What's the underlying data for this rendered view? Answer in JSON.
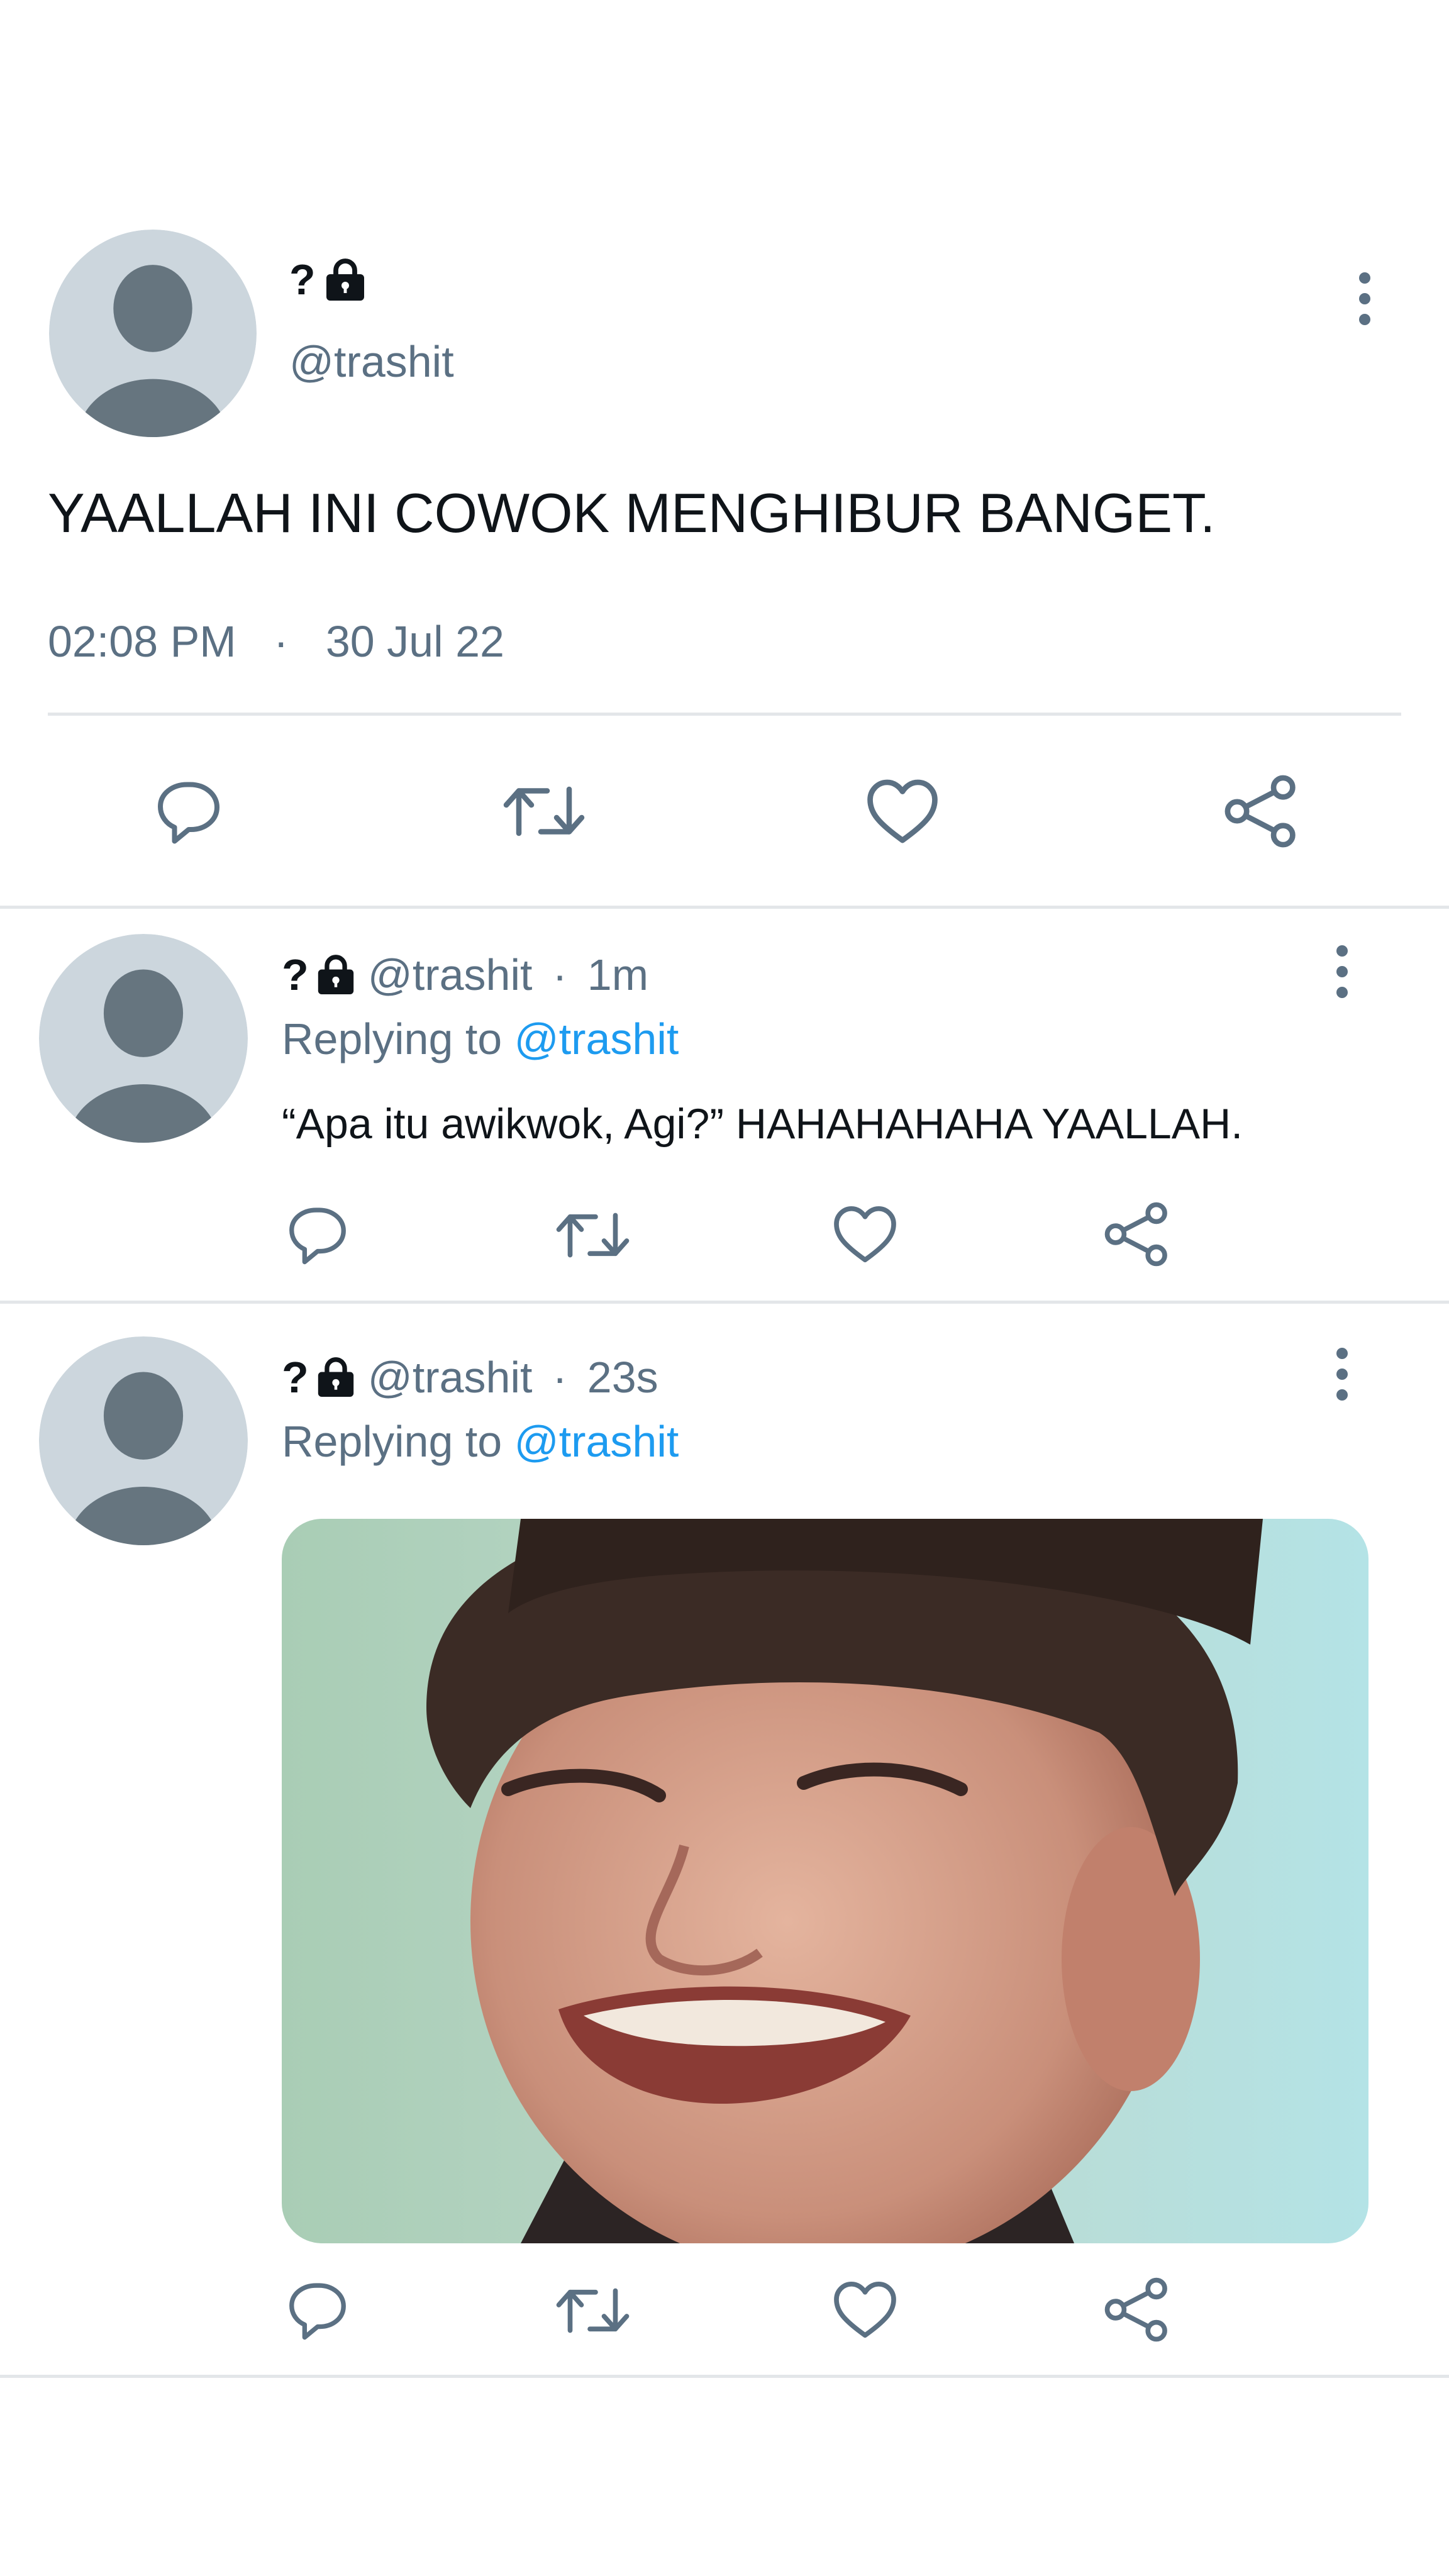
{
  "main_tweet": {
    "name": "?",
    "handle": "@trashit",
    "text": "YAALLAH INI COWOK MENGHIBUR BANGET.",
    "time": "02:08 PM",
    "separator": "·",
    "date": "30 Jul 22"
  },
  "replies": [
    {
      "name": "?",
      "handle": "@trashit",
      "separator": "·",
      "age": "1m",
      "replying_prefix": "Replying to",
      "replying_handle": "@trashit",
      "text": "“Apa itu awikwok, Agi?” HAHAHAHAHA YAALLAH."
    },
    {
      "name": "?",
      "handle": "@trashit",
      "separator": "·",
      "age": "23s",
      "replying_prefix": "Replying to",
      "replying_handle": "@trashit",
      "image_alt": "photo"
    }
  ],
  "icons": {
    "reply": "reply-icon",
    "retweet": "retweet-icon",
    "like": "heart-icon",
    "share": "share-icon",
    "more": "more-vertical-icon",
    "lock": "lock-icon"
  },
  "colors": {
    "text": "#0f1419",
    "secondary": "#5b7083",
    "link": "#1d9bf0",
    "avatar_bg": "#ccd6dd",
    "avatar_fg": "#66757f",
    "divider": "#e3e6e9"
  }
}
